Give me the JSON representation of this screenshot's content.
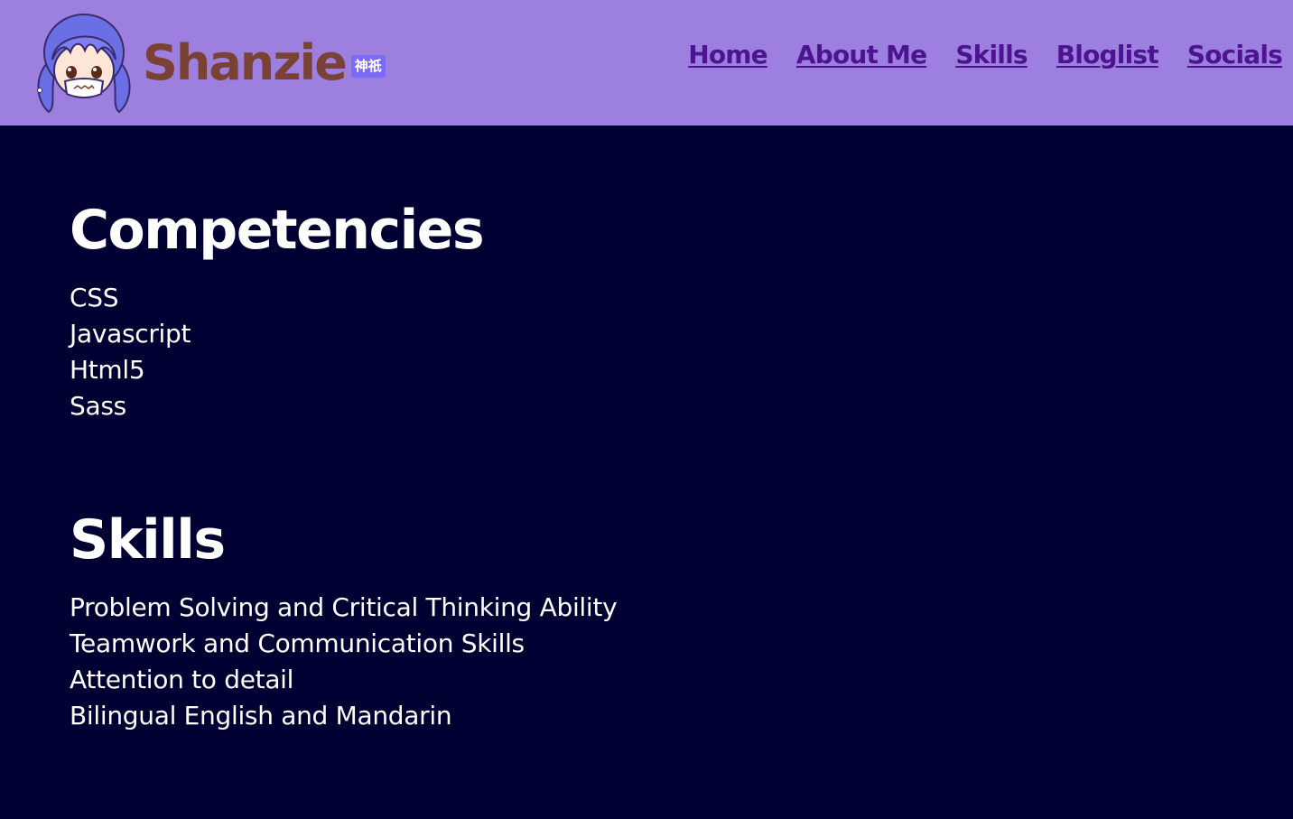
{
  "header": {
    "brand": "Shanzie",
    "brand_badge": "神祇",
    "avatar_icon": "anime-girl-avatar-icon"
  },
  "nav": {
    "items": [
      {
        "label": "Home"
      },
      {
        "label": "About Me"
      },
      {
        "label": "Skills"
      },
      {
        "label": "Bloglist"
      },
      {
        "label": "Socials"
      }
    ]
  },
  "competencies": {
    "title": "Competencies",
    "items": [
      "CSS",
      "Javascript",
      "Html5",
      "Sass"
    ]
  },
  "skills": {
    "title": "Skills",
    "items": [
      "Problem Solving and Critical Thinking Ability",
      "Teamwork and Communication Skills",
      "Attention to detail",
      "Bilingual English and Mandarin"
    ]
  },
  "colors": {
    "header_bg": "#9d7fe0",
    "page_bg": "#000033",
    "nav_link": "#4e1390",
    "brand": "#7a4234",
    "text": "#ffffff"
  }
}
